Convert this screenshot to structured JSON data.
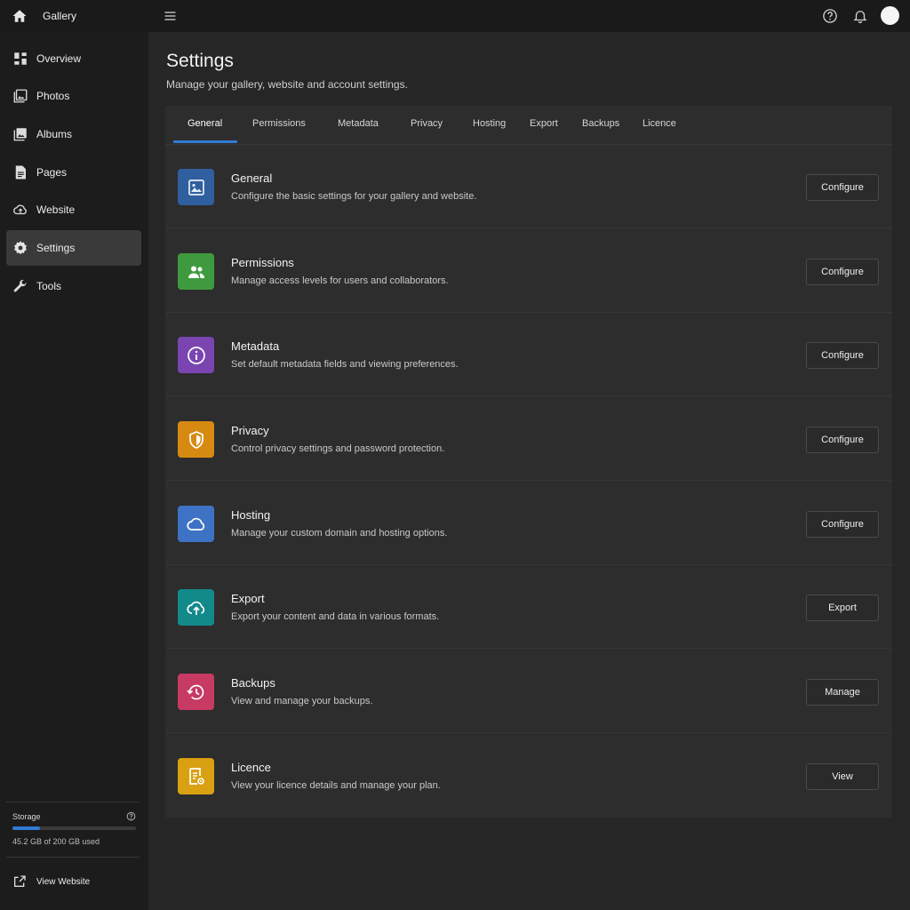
{
  "topbar": {
    "title": "Gallery",
    "icons": [
      "home-icon",
      "menu-icon",
      "help-icon",
      "bell-icon",
      "avatar"
    ]
  },
  "sidebar": {
    "items": [
      {
        "label": "Overview",
        "icon": "dashboard-icon"
      },
      {
        "label": "Photos",
        "icon": "photos-icon"
      },
      {
        "label": "Albums",
        "icon": "albums-icon"
      },
      {
        "label": "Pages",
        "icon": "pages-icon"
      },
      {
        "label": "Website",
        "icon": "cloud-icon"
      },
      {
        "label": "Settings",
        "icon": "gear-icon",
        "active": true
      },
      {
        "label": "Tools",
        "icon": "wrench-icon"
      }
    ],
    "storage": {
      "label": "Storage",
      "used_text": "45.2 GB of 200 GB used",
      "used_fraction": 0.226,
      "bar_color": "#2f7bd6"
    },
    "view_website": "View Website"
  },
  "main": {
    "title": "Settings",
    "subtitle": "Manage your gallery, website and account settings.",
    "tabs": [
      "General",
      "Permissions",
      "Metadata",
      "Privacy",
      "Hosting",
      "Export",
      "Backups",
      "Licence"
    ],
    "active_tab": "General",
    "rows": [
      {
        "title": "General",
        "desc": "Configure the basic settings for your gallery and website.",
        "button": "Configure",
        "color": "#2f5f9e",
        "icon": "image-icon"
      },
      {
        "title": "Permissions",
        "desc": "Manage access levels for users and collaborators.",
        "button": "Configure",
        "color": "#3f9a3f",
        "icon": "users-icon"
      },
      {
        "title": "Metadata",
        "desc": "Set default metadata fields and viewing preferences.",
        "button": "Configure",
        "color": "#7a45b0",
        "icon": "info-icon"
      },
      {
        "title": "Privacy",
        "desc": "Control privacy settings and password protection.",
        "button": "Configure",
        "color": "#d68a12",
        "icon": "shield-icon"
      },
      {
        "title": "Hosting",
        "desc": "Manage your custom domain and hosting options.",
        "button": "Configure",
        "color": "#3e72c4",
        "icon": "cloud-icon"
      },
      {
        "title": "Export",
        "desc": "Export your content and data in various formats.",
        "button": "Export",
        "color": "#138a8a",
        "icon": "cloud-upload-icon"
      },
      {
        "title": "Backups",
        "desc": "View and manage your backups.",
        "button": "Manage",
        "color": "#c63a64",
        "icon": "history-icon"
      },
      {
        "title": "Licence",
        "desc": "View your licence details and manage your plan.",
        "button": "View",
        "color": "#d9a012",
        "icon": "licence-icon"
      }
    ]
  }
}
